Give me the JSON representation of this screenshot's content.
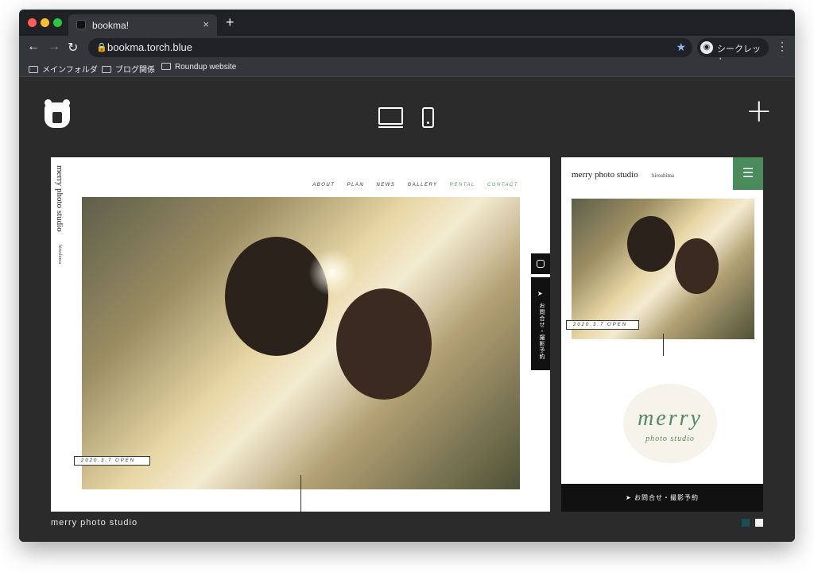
{
  "browser": {
    "tab_title": "bookma!",
    "tab_close": "×",
    "new_tab": "+",
    "back": "←",
    "forward": "→",
    "reload": "↻",
    "url": "bookma.torch.blue",
    "star": "★",
    "incognito_label": "シークレット",
    "menu": "⋮",
    "bookmarks": [
      "メインフォルダ",
      "ブログ関係",
      "Roundup website"
    ]
  },
  "app": {
    "plus": "+"
  },
  "pc_preview": {
    "site_title": "merry photo studio",
    "site_sub": "hiroshima",
    "nav": [
      "ABOUT",
      "PLAN",
      "NEWS",
      "GALLERY",
      "RENTAL",
      "CONTACT"
    ],
    "date_badge": "2020.3.7 OPEN",
    "contact_vertical": "お問合せ・撮影予約",
    "arrow": "➤"
  },
  "sp_preview": {
    "site_title": "merry photo studio",
    "site_sub": "hiroshima",
    "menu": "☰",
    "date_badge": "2020.3.7 OPEN",
    "brand_main": "merry",
    "brand_sub": "photo studio",
    "bottom_bar": "➤  お問合せ・撮影予約"
  },
  "footer": {
    "site_name": "merry photo studio"
  },
  "colors": {
    "accent_green": "#4a8b5c",
    "swatch_dark": "#174e5a",
    "swatch_light": "#f2f2f2"
  }
}
